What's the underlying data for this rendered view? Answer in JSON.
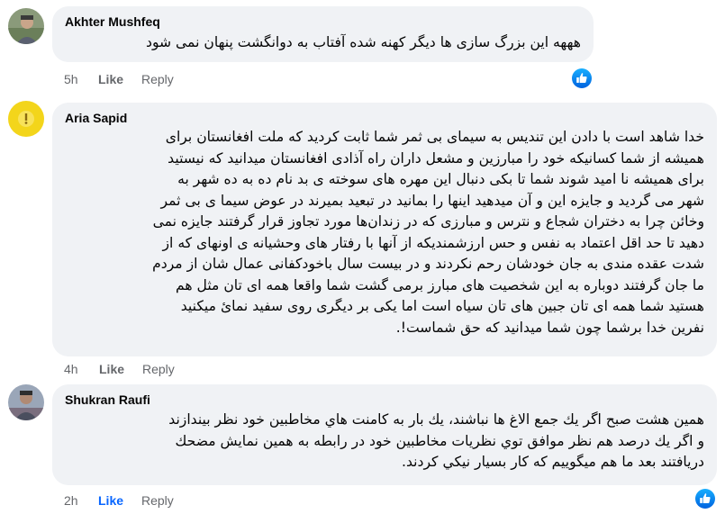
{
  "comments": [
    {
      "author": "Akhter Mushfeq",
      "lines": [
        "هههه این بزرگ سازی ها دیگر کهنه شده آفتاب به دوانگشت پنهان نمی شود"
      ],
      "time": "5h",
      "like_label": "Like",
      "reply_label": "Reply",
      "liked": false,
      "reaction_icon": "like-reaction-icon"
    },
    {
      "author": "Aria Sapid",
      "lines": [
        "خدا شاهد است با دادن این تندیس به سیمای بی ثمر شما ثابت کردید که ملت افغانستان برای",
        "همیشه از شما کسانیکه خود را مبارزین و مشعل داران راه آذادی افغانستان میدانید که نیستید",
        "برای همیشه نا امید شوند شما تا بکی دنبال این مهره های سوخته ی بد نام ده به ده شهر به",
        "شهر می گردید و جایزه این و آن میدهید اینها را بمانید در تبعید بمیرند در عوض سیما ی بی ثمر",
        "وخائن چرا به دختران شجاع و نترس و مبارزی که در زندان‌ها مورد تجاوز قرار گرفتند جایزه نمی",
        "دهید تا حد اقل اعتماد به نفس و حس ارزشمندیکه از آنها با رفتار های وحشیانه ی اونهای که از",
        "شدت عقده مندی به جان خودشان رحم نکردند و در بیست سال باخودکفانی عمال شان از مردم",
        "ما جان گرفتند دوباره به این شخصیت های مبارز برمی گشت شما واقعا همه ای تان مثل هم",
        "هستید شما همه ای تان جبین های تان سیاه است اما یکی بر دیگری روی سفید نمائ میکنید",
        "نفرین خدا برشما چون شما میدانید که حق شماست!."
      ],
      "time": "4h",
      "like_label": "Like",
      "reply_label": "Reply",
      "liked": false
    },
    {
      "author": "Shukran Raufi",
      "lines": [
        "همين هشت صبح اگر يك جمع الاغ ها نباشند، يك بار به كامنت هاي مخاطبين خود نظر بيندازند",
        "و اگر يك درصد هم نظر موافق توي نظريات مخاطبين خود در رابطه به همين نمايش مضحك",
        "دريافتند بعد ما هم ميگوييم كه كار بسيار نيكي كردند."
      ],
      "time": "2h",
      "like_label": "Like",
      "reply_label": "Reply",
      "liked": true,
      "reaction_icon": "like-reaction-icon"
    }
  ],
  "colors": {
    "bubble": "#f0f2f5",
    "text": "#050505",
    "meta": "#65676b",
    "like_active": "#0866ff"
  }
}
